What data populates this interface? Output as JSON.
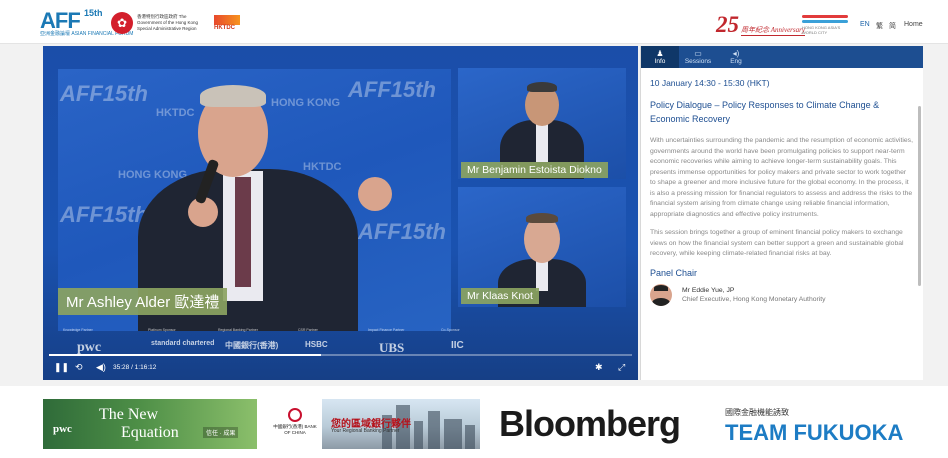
{
  "header": {
    "aff_logo": "AFF",
    "aff_sup": "15th",
    "aff_sub": "亞洲金融論壇 ASIAN FINANCIAL FORUM",
    "gov_text": "香港特別行政區政府 The Government of the Hong Kong Special Administrative Region",
    "hktdc": "HKTDC",
    "anniversary_number": "25",
    "anniversary_text": "周年紀念 Anniversary",
    "brand_text": "HONG KONG ASIA'S WORLD CITY",
    "lang_en": "EN",
    "lang_tc": "繁",
    "lang_sc": "简",
    "home": "Home"
  },
  "video": {
    "main_speaker": "Mr Ashley Alder 歐達禮",
    "pip1_speaker": "Mr Benjamin Estoista Diokno",
    "pip2_speaker": "Mr Klaas Knot",
    "backdrop": [
      "AFF15th",
      "HKTDC",
      "HONG KONG"
    ],
    "sponsor_labels": [
      "Knowledge Partner",
      "Platinum Sponsor",
      "Regional Banking Partner",
      "CSR Partner",
      "Impact Finance Partner",
      "Co-Sponsor"
    ],
    "sponsor_logos": [
      "pwc",
      "standard chartered",
      "中國銀行(香港)",
      "HSBC",
      "UBS",
      "IIC"
    ],
    "time": "35:28 / 1:16:12",
    "progress": 0.466
  },
  "panel": {
    "tabs": [
      {
        "icon": "♟",
        "label": "Info"
      },
      {
        "icon": "▭",
        "label": "Sessions"
      },
      {
        "icon": "◂)",
        "label": "Eng"
      }
    ],
    "date": "10 January 14:30 - 15:30 (HKT)",
    "title": "Policy Dialogue – Policy Responses to Climate Change & Economic Recovery",
    "para1": "With uncertainties surrounding the pandemic and the resumption of economic activities, governments around the world have been promulgating policies to support near-term economic recoveries while aiming to achieve longer-term sustainability goals. This presents immense opportunities for policy makers and private sector to work together to shape a greener and more inclusive future for the global economy. In the process, it is also a pressing mission for financial regulators to assess and address the risks to the financial system arising from climate change using reliable financial information, appropriate diagnostics and effective policy instruments.",
    "para2": "This session brings together a group of eminent financial policy makers to exchange views on how the financial system can better support a green and sustainable global recovery, while keeping climate-related financial risks at bay.",
    "chair_heading": "Panel Chair",
    "chair_name": "Mr Eddie Yue, JP",
    "chair_role": "Chief Executive, Hong Kong Monetary Authority"
  },
  "sponsors": {
    "pwc_logo": "pwc",
    "pwc_tag1": "The New",
    "pwc_tag2": "Equation",
    "pwc_tag3": "信任 · 成果",
    "boc_logo": "中國銀行(香港) BANK OF CHINA",
    "boc_ad1": "您的區域銀行夥伴",
    "boc_ad2": "Your Regional Banking Partner",
    "bloomberg": "Bloomberg",
    "fukuoka_sub": "國際金融機能誘致",
    "fukuoka": "TEAM FUKUOKA"
  },
  "colors": {
    "accent": "#1d4e91",
    "nameplate": "#8ba361",
    "video_bg": "#1b4ea9"
  }
}
